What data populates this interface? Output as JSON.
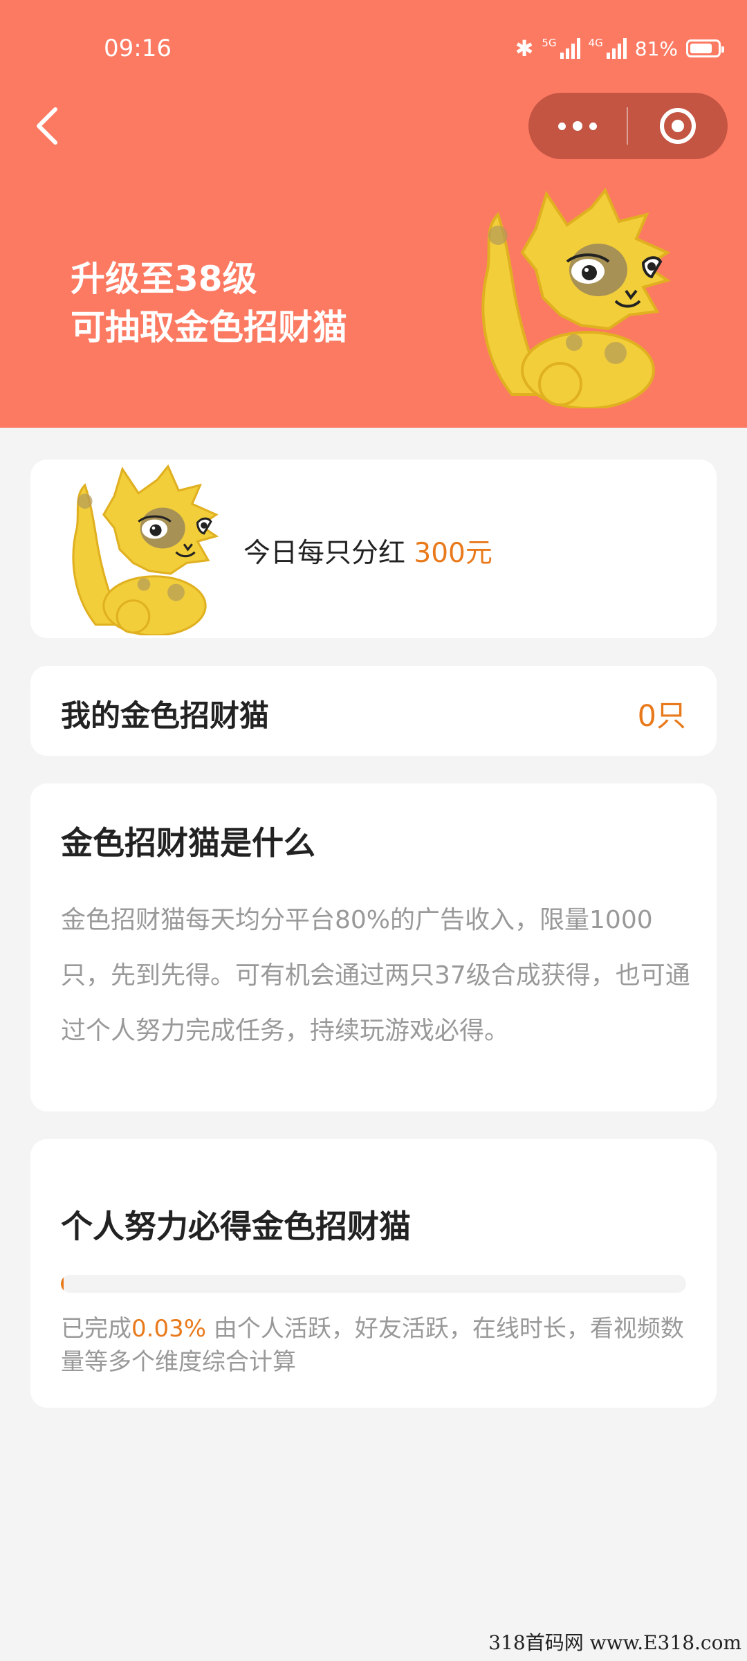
{
  "status_bar": {
    "time": "09:16",
    "bluetooth_icon": "bluetooth-icon",
    "sim1_tag": "5G",
    "sim2_tag": "4G",
    "battery_percent": "81%",
    "battery_level": 0.81
  },
  "nav": {
    "back_icon": "chevron-left-icon",
    "more_icon": "more-dots-icon",
    "close_icon": "target-circle-icon"
  },
  "hero": {
    "line1": "升级至38级",
    "line2": "可抽取金色招财猫",
    "image_icon": "golden-cat-icon"
  },
  "dividend": {
    "label": "今日每只分红 ",
    "value": "300元"
  },
  "mine": {
    "label": "我的金色招财猫",
    "count": "0只"
  },
  "what": {
    "title": "金色招财猫是什么",
    "description": "金色招财猫每天均分平台80%的广告收入，限量1000只，先到先得。可有机会通过两只37级合成获得，也可通过个人努力完成任务，持续玩游戏必得。"
  },
  "effort": {
    "title": "个人努力必得金色招财猫",
    "progress_fraction": 0.0003,
    "completed_prefix": "已完成",
    "completed_percent": "0.03%",
    "description": " 由个人活跃，好友活跃，在线时长，看视频数量等多个维度综合计算"
  },
  "watermark": "318首码网 www.E318.com",
  "colors": {
    "header_bg": "#fd7a62",
    "accent": "#e97a1c",
    "page_bg": "#f4f4f4"
  }
}
